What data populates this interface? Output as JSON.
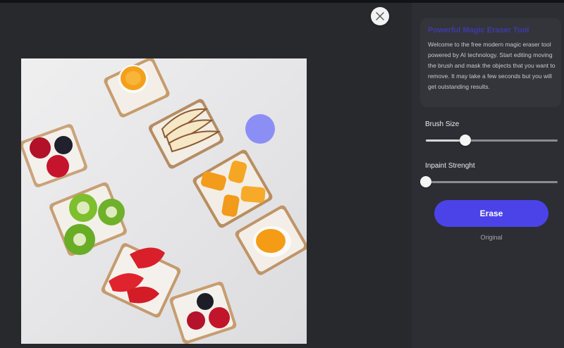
{
  "close_button": {
    "icon": "close-icon"
  },
  "editor": {
    "photo_description_icon": "food-photo",
    "brush_color": "#8b8ff5"
  },
  "info_card": {
    "title": "Powerful Magic Eraser Tool",
    "text": "Welcome to the free modern magic eraser tool powered by AI technology. Start editing moving the brush and mask the objects that you want to remove. It may take a few seconds but you will get outstanding results."
  },
  "controls": {
    "brush_size": {
      "label": "Brush Size",
      "value": 0.3
    },
    "inpaint_strength": {
      "label": "Inpaint Strenght",
      "value": 0.0
    }
  },
  "actions": {
    "erase_label": "Erase",
    "original_label": "Original",
    "accent_color": "#4b43e8"
  }
}
